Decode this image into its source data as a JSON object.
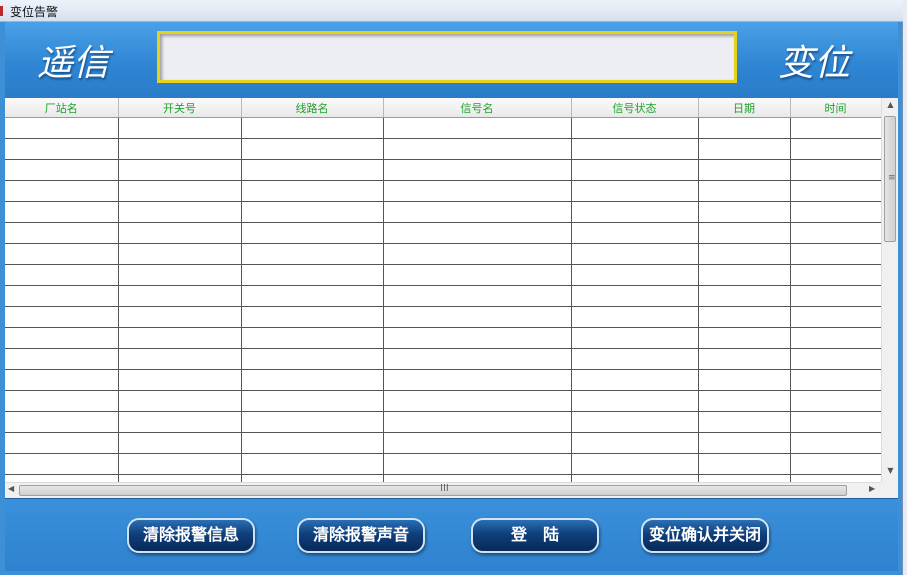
{
  "window": {
    "title": "变位告警"
  },
  "banner": {
    "left_text": "遥信",
    "right_text": "变位"
  },
  "table": {
    "columns": [
      "厂站名",
      "开关号",
      "线路名",
      "信号名",
      "信号状态",
      "日期",
      "时间"
    ],
    "row_count": 18
  },
  "buttons": {
    "clear_info": "清除报警信息",
    "clear_sound": "清除报警声音",
    "login": "登　陆",
    "confirm_close": "变位确认并关闭"
  },
  "colors": {
    "header_text": "#21a12c",
    "banner_box_border": "#e6d21a",
    "window_bg": "#3d8fd6"
  },
  "icons": {
    "scroll_up": "▲",
    "scroll_down": "▼",
    "scroll_left": "◀",
    "scroll_right": "▶",
    "vgrip": "≡",
    "hgrip": "III"
  }
}
